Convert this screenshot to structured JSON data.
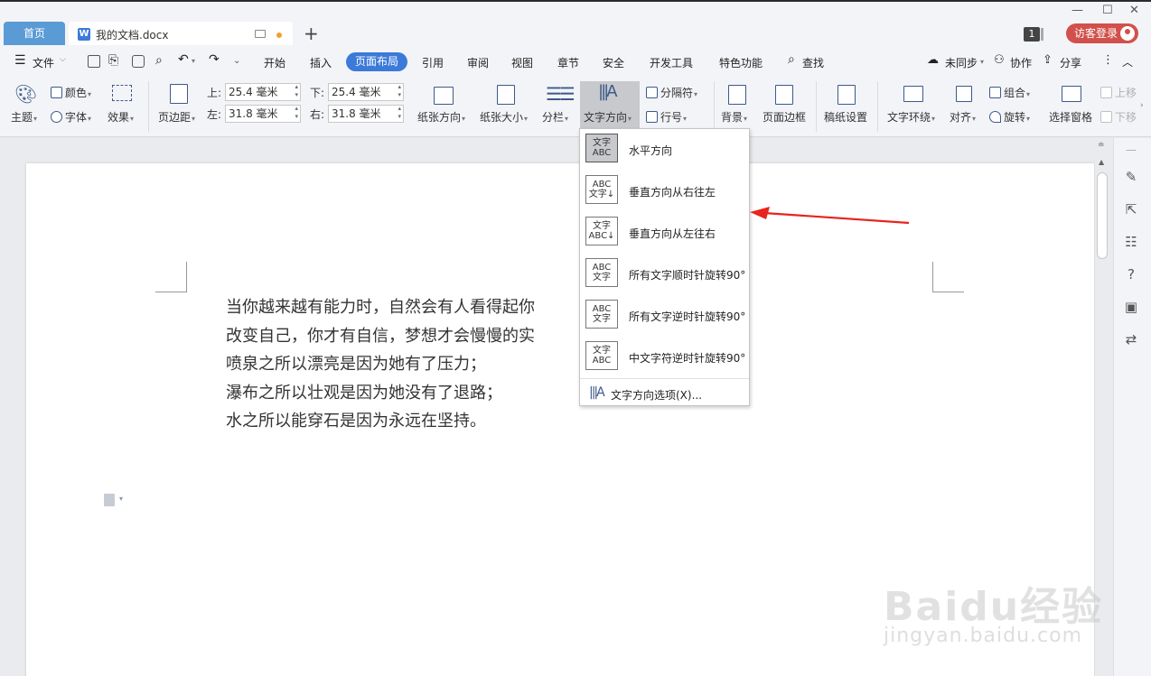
{
  "window": {
    "tabs": [
      {
        "label": "首页"
      },
      {
        "label": "我的文档.docx"
      }
    ],
    "new_tab": "+",
    "page_counter": "1",
    "login_label": "访客登录"
  },
  "menu": {
    "file": "文件",
    "items": [
      "开始",
      "插入",
      "页面布局",
      "引用",
      "审阅",
      "视图",
      "章节",
      "安全",
      "开发工具",
      "特色功能"
    ],
    "active": "页面布局",
    "search": "查找",
    "sync": "未同步",
    "collab": "协作",
    "share": "分享"
  },
  "ribbon": {
    "theme": "主题",
    "color": "颜色",
    "font": "字体",
    "effect": "效果",
    "margin": "页边距",
    "margin_top_label": "上:",
    "margin_top": "25.4 毫米",
    "margin_bottom_label": "下:",
    "margin_bottom": "25.4 毫米",
    "margin_left_label": "左:",
    "margin_left": "31.8 毫米",
    "margin_right_label": "右:",
    "margin_right": "31.8 毫米",
    "orientation": "纸张方向",
    "paper_size": "纸张大小",
    "columns": "分栏",
    "text_direction": "文字方向",
    "separator": "分隔符",
    "line_number": "行号",
    "background": "背景",
    "page_border": "页面边框",
    "manuscript": "稿纸设置",
    "text_wrap": "文字环绕",
    "align": "对齐",
    "group": "组合",
    "rotate": "旋转",
    "selection_pane": "选择窗格",
    "bring_up": "上移",
    "send_down": "下移"
  },
  "dropdown": {
    "items": [
      {
        "label": "水平方向",
        "icon": "文字\nABC",
        "selected": true
      },
      {
        "label": "垂直方向从右往左",
        "icon": "ABC\n文字↓"
      },
      {
        "label": "垂直方向从左往右",
        "icon": "文字\nABC↓"
      },
      {
        "label": "所有文字顺时针旋转90°",
        "icon": "ABC\n文字"
      },
      {
        "label": "所有文字逆时针旋转90°",
        "icon": "ABC\n文字"
      },
      {
        "label": "中文字符逆时针旋转90°",
        "icon": "文字\nABC"
      }
    ],
    "options": "文字方向选项(X)..."
  },
  "document": {
    "lines": [
      "当你越来越有能力时，自然会有人看得起你",
      "改变自己，你才有自信，梦想才会慢慢的实",
      "喷泉之所以漂亮是因为她有了压力；",
      "瀑布之所以壮观是因为她没有了退路；",
      "水之所以能穿石是因为永远在坚持。"
    ]
  },
  "watermark": {
    "brand": "Baidu经验",
    "url": "jingyan.baidu.com"
  },
  "colors": {
    "accent": "#3b7ad8",
    "home_tab": "#5b9bd5",
    "login": "#d2504b",
    "arrow": "#e8241c"
  }
}
